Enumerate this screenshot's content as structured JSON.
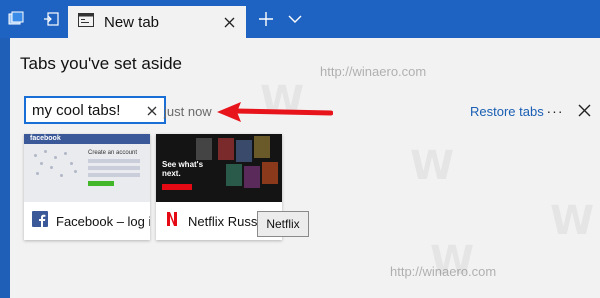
{
  "tab_strip": {
    "active_tab_title": "New tab",
    "icons": {
      "set_aside": "tabs-set-aside-icon",
      "restore": "tabs-restore-icon",
      "new_tab": "plus-icon",
      "tab_menu": "chevron-down-icon"
    }
  },
  "panel": {
    "title": "Tabs you've set aside",
    "group": {
      "name_value": "my cool tabs!",
      "time_label": "just now",
      "restore_label": "Restore tabs",
      "more_glyph": "···"
    },
    "cards": [
      {
        "title": "Facebook – log in",
        "icon": "facebook-icon"
      },
      {
        "title": "Netflix Russia",
        "icon": "netflix-icon"
      }
    ],
    "tooltip": "Netflix",
    "thumb_fb": {
      "brand": "facebook",
      "heading": "Create an account"
    },
    "thumb_nf": {
      "headline": "See what's next."
    }
  },
  "watermark": "http://winaero.com",
  "colors": {
    "tab_strip": "#1e63c2",
    "accent": "#1a6fd6",
    "arrow": "#e8141c",
    "link": "#1a5fb4"
  }
}
